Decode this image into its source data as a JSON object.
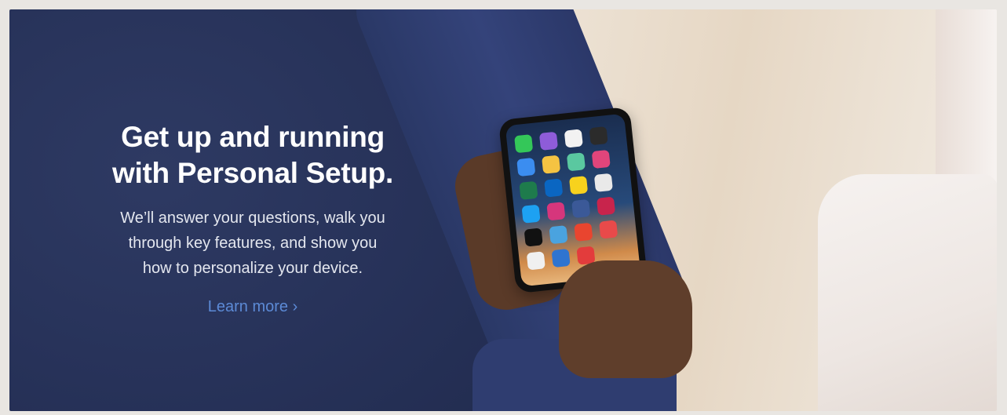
{
  "banner": {
    "headline_line1": "Get up and running",
    "headline_line2": "with Personal Setup.",
    "body_line1": "We’ll answer your questions, walk you",
    "body_line2": "through key features, and show you",
    "body_line3": "how to personalize your device.",
    "link_label": "Learn more",
    "link_chevron": "›",
    "colors": {
      "panel": "#273259",
      "link": "#5c8ad6",
      "text": "#ffffff"
    }
  }
}
